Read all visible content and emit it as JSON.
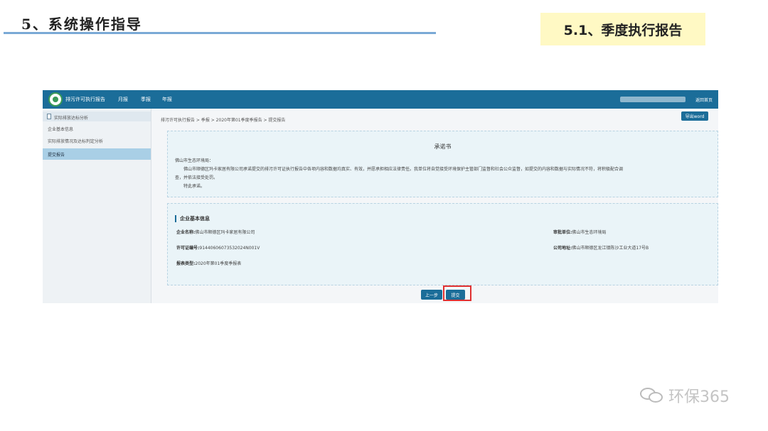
{
  "slide": {
    "title": "5、系统操作指导",
    "section": "5.1、季度执行报告"
  },
  "app": {
    "name": "排污许可执行报告",
    "nav": [
      "月报",
      "季报",
      "年报"
    ],
    "back_home": "返回首页",
    "sidebar": {
      "header": "实际排放达标分析",
      "items": [
        "企业基本信息",
        "实际排放情况及达标判定分析",
        "提交报告"
      ],
      "active_index": 2
    },
    "breadcrumb": "排污许可执行报告 > 季报 > 2020年第01季度季报告 > 提交报告",
    "export_label": "导出word",
    "pledge": {
      "title": "承诺书",
      "addressee": "佛山市生态环境局：",
      "body_line1": "佛山市顺德区玛卡家居有限公司承诺提交的排污许可证执行报告中各项内容和数据均真实、有效，并愿承担相应法律责任。我单位将自觉接受环境保护主管部门监督和社会公众监督，如提交的内容和数据与实际情况不符，将积极配合调",
      "body_line2": "查，并依法接受处罚。",
      "closing": "特此承诺。"
    },
    "company": {
      "section_title": "企业基本信息",
      "name_label": "企业名称:",
      "name_value": "佛山市顺德区玛卡家居有限公司",
      "authority_label": "审批单位:",
      "authority_value": "佛山市生态环境局",
      "license_label": "许可证编号:",
      "license_value": "91440606073532024N001V",
      "address_label": "公司地址:",
      "address_value": "佛山市顺德区龙江镇陈沙工业大道17号B",
      "report_type_label": "报表类型:",
      "report_type_value": "2020年第01季度季报表"
    },
    "buttons": {
      "prev": "上一步",
      "submit": "提交"
    }
  },
  "watermark": "环保365"
}
